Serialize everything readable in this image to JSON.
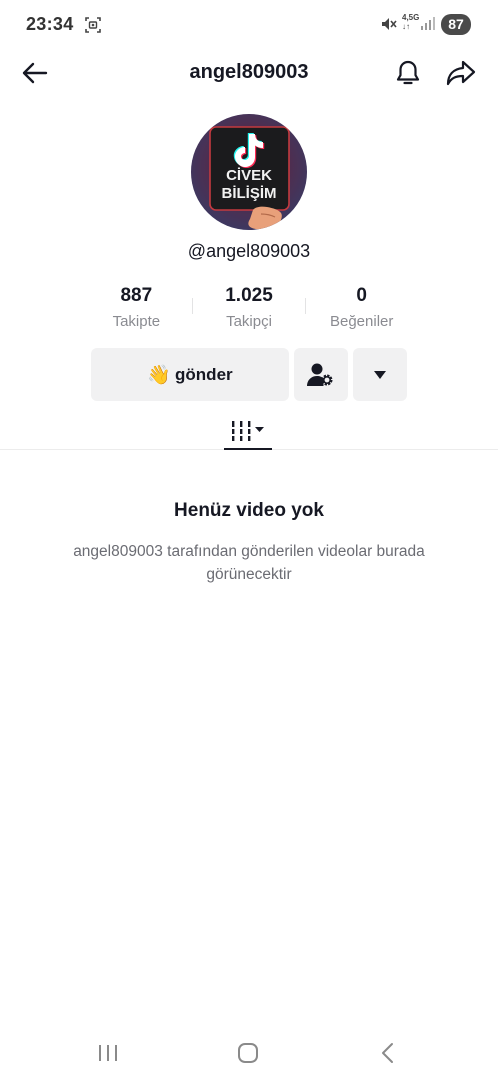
{
  "status_bar": {
    "time": "23:34",
    "network_top": "4,5G",
    "network_bottom": "↓↑",
    "battery": "87"
  },
  "header": {
    "title": "angel809003"
  },
  "avatar": {
    "text_line1": "CİVEK",
    "text_line2": "BİLİŞİM"
  },
  "profile": {
    "handle": "@angel809003"
  },
  "stats": [
    {
      "value": "887",
      "label": "Takipte"
    },
    {
      "value": "1.025",
      "label": "Takipçi"
    },
    {
      "value": "0",
      "label": "Beğeniler"
    }
  ],
  "actions": {
    "send_emoji": "👋",
    "send_label": "gönder"
  },
  "empty_state": {
    "title": "Henüz video yok",
    "description": "angel809003 tarafından gönderilen videolar burada görünecektir"
  },
  "colors": {
    "text_primary": "#161823",
    "text_secondary": "#8a8b91",
    "button_bg": "#f1f1f2"
  }
}
